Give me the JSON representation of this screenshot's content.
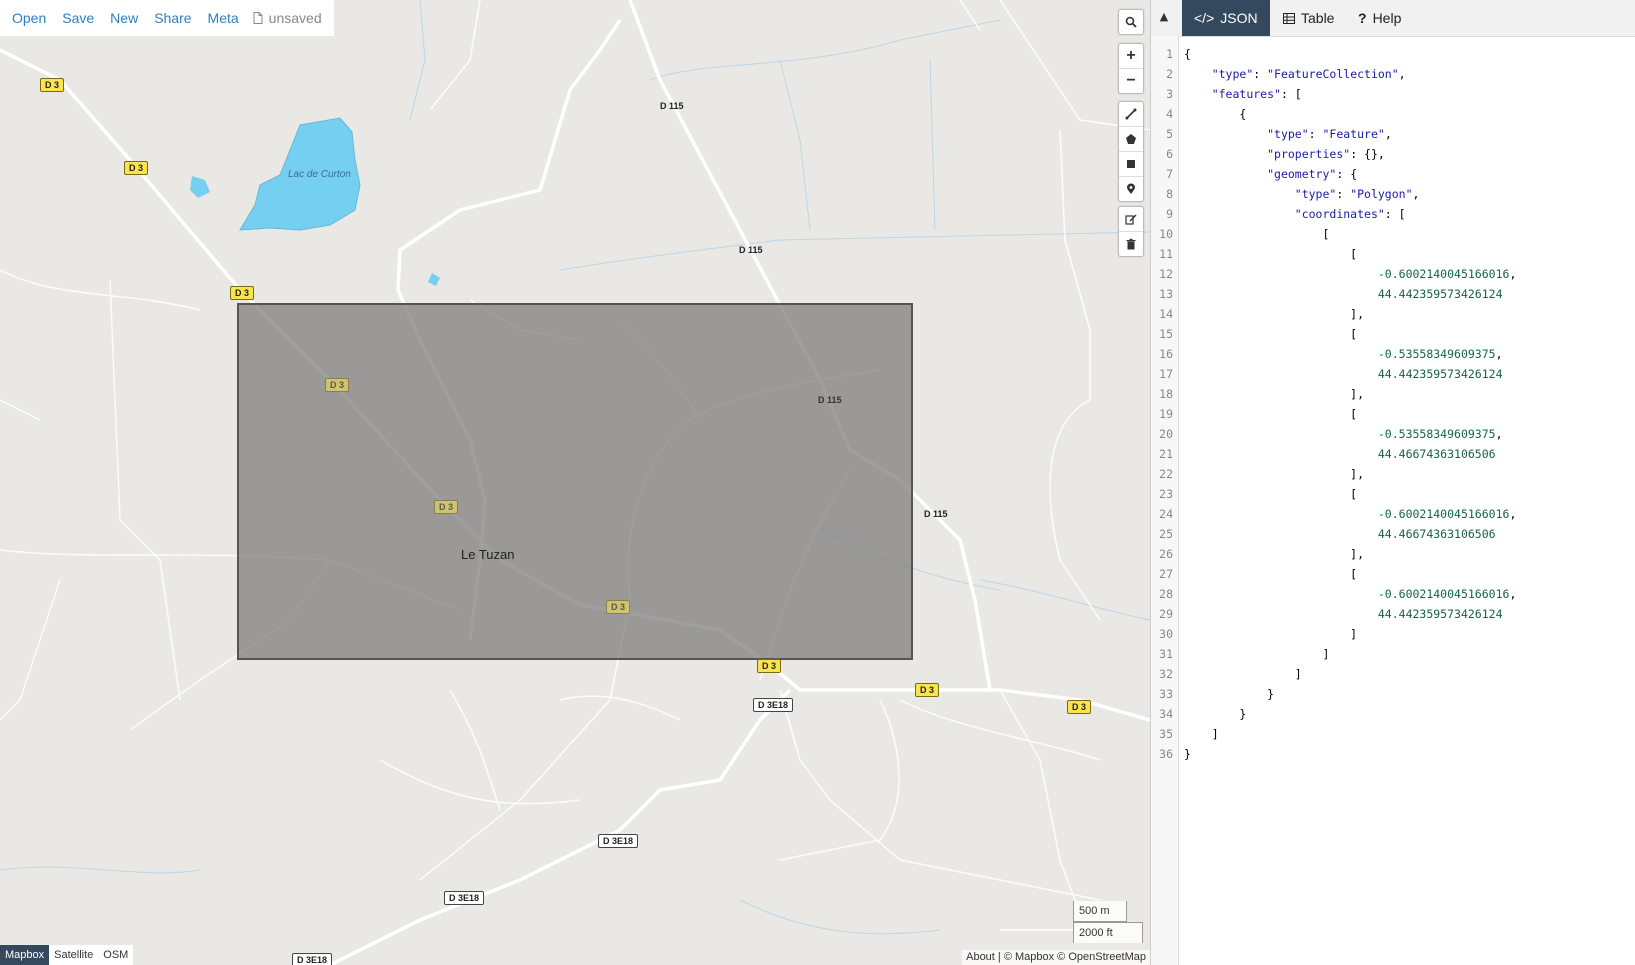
{
  "toolbar": {
    "open": "Open",
    "save": "Save",
    "new": "New",
    "share": "Share",
    "meta": "Meta",
    "status": "unsaved"
  },
  "map_controls": {
    "search_icon": "search-icon",
    "zoom_in": "+",
    "zoom_out": "−",
    "draw_tools": [
      "line-icon",
      "polygon-icon",
      "rectangle-icon",
      "marker-icon"
    ],
    "edit_tools": [
      "edit-icon",
      "trash-icon"
    ]
  },
  "map_labels": {
    "lake": "Lac de Curton",
    "town": "Le Tuzan",
    "roads": {
      "d3": "D 3",
      "d115": "D 115",
      "d3e18": "D 3E18"
    }
  },
  "scale": {
    "metric": "500 m",
    "imperial": "2000 ft"
  },
  "layers": {
    "items": [
      "Mapbox",
      "Satellite",
      "OSM"
    ],
    "active": "Mapbox"
  },
  "attribution": "About | © Mapbox © OpenStreetMap",
  "colors": {
    "link": "#2f7fc2",
    "tab_active_bg": "#34495e",
    "selection_fill": "#7f7f7f",
    "water": "#75cff0",
    "map_bg": "#e9e8e4",
    "road_shield": "#f9e54b"
  },
  "panel": {
    "tabs": [
      {
        "label": "JSON",
        "icon": "code-icon",
        "active": true
      },
      {
        "label": "Table",
        "icon": "table-icon",
        "active": false
      },
      {
        "label": "Help",
        "icon": "question-icon",
        "active": false
      }
    ],
    "json_lines": [
      "{",
      "    \"type\": \"FeatureCollection\",",
      "    \"features\": [",
      "        {",
      "            \"type\": \"Feature\",",
      "            \"properties\": {},",
      "            \"geometry\": {",
      "                \"type\": \"Polygon\",",
      "                \"coordinates\": [",
      "                    [",
      "                        [",
      "                            -0.6002140045166016,",
      "                            44.442359573426124",
      "                        ],",
      "                        [",
      "                            -0.53558349609375,",
      "                            44.442359573426124",
      "                        ],",
      "                        [",
      "                            -0.53558349609375,",
      "                            44.46674363106506",
      "                        ],",
      "                        [",
      "                            -0.6002140045166016,",
      "                            44.46674363106506",
      "                        ],",
      "                        [",
      "                            -0.6002140045166016,",
      "                            44.442359573426124",
      "                        ]",
      "                    ]",
      "                ]",
      "            }",
      "        }",
      "    ]",
      "}"
    ]
  }
}
